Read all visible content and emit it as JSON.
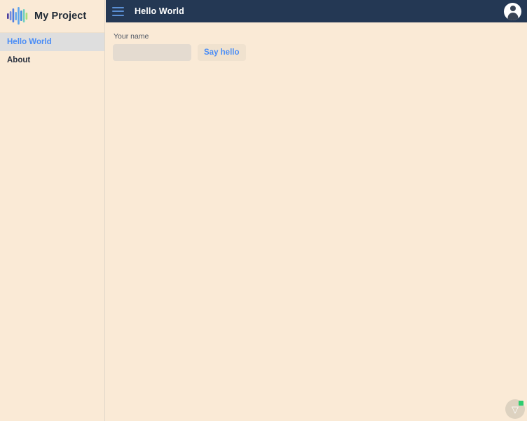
{
  "sidebar": {
    "brand": {
      "title": "My Project",
      "logo_icon": "bar-chart-logo-icon",
      "logo_bar_colors": [
        "#4b3f9e",
        "#6f8ae0",
        "#4f7de0",
        "#6aa8e8",
        "#5ba3ef",
        "#3f8fe0",
        "#6fd0c0",
        "#7ed6b8",
        "#a8e07a",
        "#b9e38a"
      ]
    },
    "items": [
      {
        "label": "Hello World",
        "active": true
      },
      {
        "label": "About",
        "active": false
      }
    ]
  },
  "topbar": {
    "menu_icon": "hamburger-menu-icon",
    "title": "Hello World",
    "avatar_icon": "user-avatar-icon",
    "background_color": "#243854",
    "title_color": "#ffffff",
    "menu_icon_color": "#5b8fd4"
  },
  "main": {
    "form": {
      "name_label": "Your name",
      "name_value": "",
      "name_placeholder": "",
      "submit_label": "Say hello"
    },
    "background_color": "#faead6",
    "accent_color": "#4a8df6"
  },
  "support_widget": {
    "icon": "chat-support-icon",
    "glyph": "▽",
    "status_color": "#2fcc6f"
  }
}
